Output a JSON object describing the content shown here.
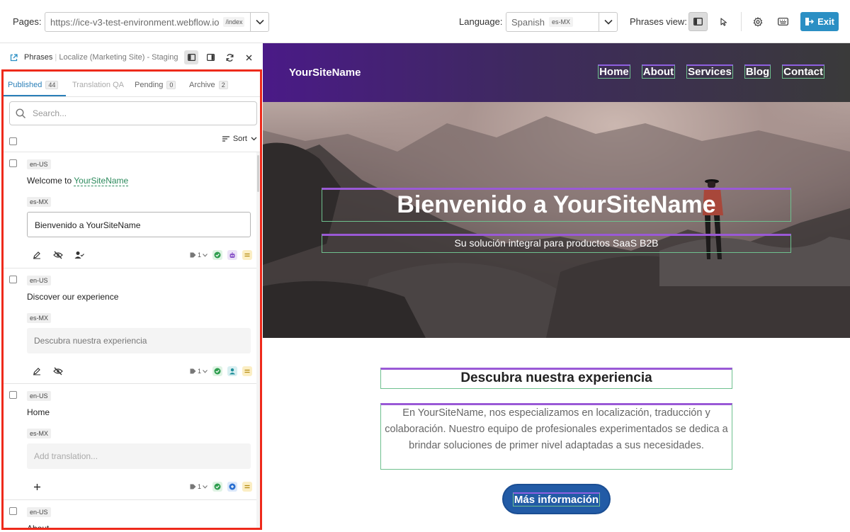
{
  "toolbar": {
    "pages_label": "Pages:",
    "url": "https://ice-v3-test-environment.webflow.io",
    "url_path": "/index",
    "language_label": "Language:",
    "language": "Spanish",
    "language_code": "es-MX",
    "phrases_view_label": "Phrases view:",
    "exit_label": "Exit",
    "accent_color": "#2b8fc4"
  },
  "panel": {
    "title": "Phrases",
    "subtitle": "Localize (Marketing Site) - Staging",
    "tabs": [
      {
        "label": "Published",
        "count": "44"
      },
      {
        "label": "Translation QA",
        "count": ""
      },
      {
        "label": "Pending",
        "count": "0"
      },
      {
        "label": "Archive",
        "count": "2"
      }
    ],
    "search_placeholder": "Search...",
    "sort_label": "Sort",
    "entries": [
      {
        "source_lang": "en-US",
        "source_prefix": "Welcome to ",
        "source_var": "YourSiteName",
        "target_lang": "es-MX",
        "translation": "Bienvenido a YourSiteName",
        "count": "1"
      },
      {
        "source_lang": "en-US",
        "source_prefix": "Discover our experience",
        "source_var": "",
        "target_lang": "es-MX",
        "translation": "Descubra nuestra experiencia",
        "count": "1"
      },
      {
        "source_lang": "en-US",
        "source_prefix": "Home",
        "source_var": "",
        "target_lang": "es-MX",
        "translation_placeholder": "Add translation...",
        "count": "1"
      },
      {
        "source_lang": "en-US",
        "source_prefix": "About",
        "source_var": ""
      }
    ]
  },
  "site": {
    "logo": "YourSiteName",
    "nav": [
      "Home",
      "About",
      "Services",
      "Blog",
      "Contact"
    ],
    "hero_title": "Bienvenido a YourSiteName",
    "hero_subtitle": "Su solución integral para productos SaaS B2B",
    "section_title": "Descubra nuestra experiencia",
    "section_body": "En YourSiteName, nos especializamos en localización, traducción y colaboración. Nuestro equipo de profesionales experimentados se dedica a brindar soluciones de primer nivel adaptadas a sus necesidades.",
    "cta": "Más información"
  },
  "icons": [
    "external-link-icon",
    "panel-left-icon",
    "panel-right-icon",
    "refresh-icon",
    "close-icon",
    "search-icon",
    "sort-icon",
    "edit-icon",
    "hide-icon",
    "assign-user-icon",
    "add-icon",
    "tag-icon",
    "check-icon",
    "robot-icon",
    "equals-icon",
    "cursor-icon",
    "gear-icon",
    "keyboard-icon",
    "exit-icon"
  ]
}
